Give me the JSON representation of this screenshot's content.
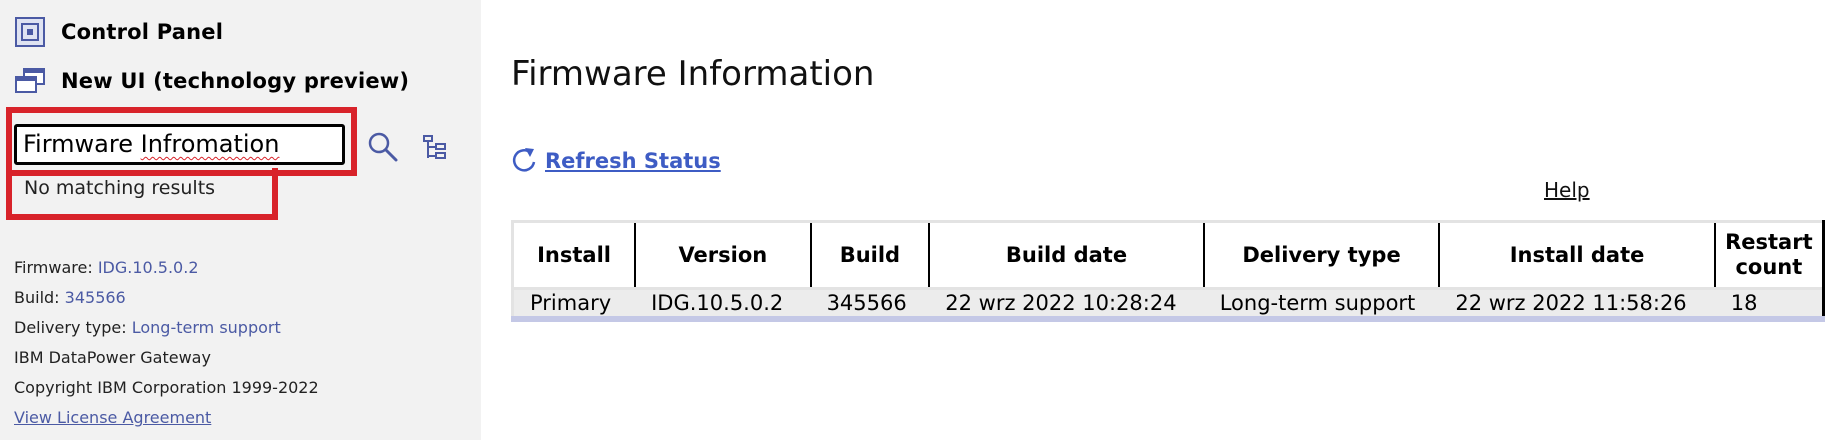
{
  "sidebar": {
    "nav": {
      "control_panel": "Control Panel",
      "new_ui": "New UI (technology preview)"
    },
    "search": {
      "value_prefix": "Firmware ",
      "value_typo": "Infromation",
      "no_results": "No matching results"
    },
    "info": {
      "firmware_label": "Firmware:",
      "firmware_value": "IDG.10.5.0.2",
      "build_label": "Build:",
      "build_value": "345566",
      "delivery_label": "Delivery type:",
      "delivery_value": "Long-term support",
      "product": "IBM DataPower Gateway",
      "copyright": "Copyright IBM Corporation 1999-2022",
      "license_link": "View License Agreement"
    }
  },
  "main": {
    "title": "Firmware Information",
    "refresh_label": "Refresh Status",
    "help_label": "Help",
    "table": {
      "headers": {
        "install": "Install",
        "version": "Version",
        "build": "Build",
        "build_date": "Build date",
        "delivery_type": "Delivery type",
        "install_date": "Install date",
        "restart_count_1": "Restart",
        "restart_count_2": "count"
      },
      "rows": [
        {
          "install": "Primary",
          "version": "IDG.10.5.0.2",
          "build": "345566",
          "build_date": "22 wrz 2022 10:28:24",
          "delivery_type": "Long-term support",
          "install_date": "22 wrz 2022 11:58:26",
          "restart_count": "18"
        }
      ]
    }
  },
  "colors": {
    "highlight": "#d8232a",
    "link": "#3e5cc4",
    "sidebar_bg": "#f2f2f2"
  },
  "icons": {
    "control_panel": "control-panel-icon",
    "new_ui": "new-window-icon",
    "search": "search-icon",
    "tree": "tree-view-icon",
    "refresh": "refresh-icon"
  }
}
